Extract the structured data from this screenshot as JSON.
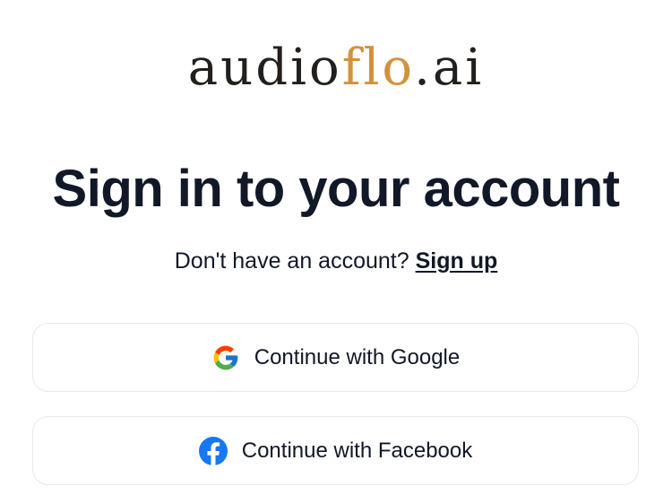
{
  "logo": {
    "part1": "audio",
    "part2": "flo",
    "part3": ".ai",
    "accent_color": "#d4913c",
    "text_color": "#231f1c"
  },
  "heading": "Sign in to your account",
  "signup_prompt": {
    "text": "Don't have an account?",
    "link": "Sign up"
  },
  "buttons": {
    "google": {
      "label": "Continue with Google",
      "icon": "google-icon"
    },
    "facebook": {
      "label": "Continue with Facebook",
      "icon": "facebook-icon",
      "icon_color": "#1877f2"
    }
  }
}
